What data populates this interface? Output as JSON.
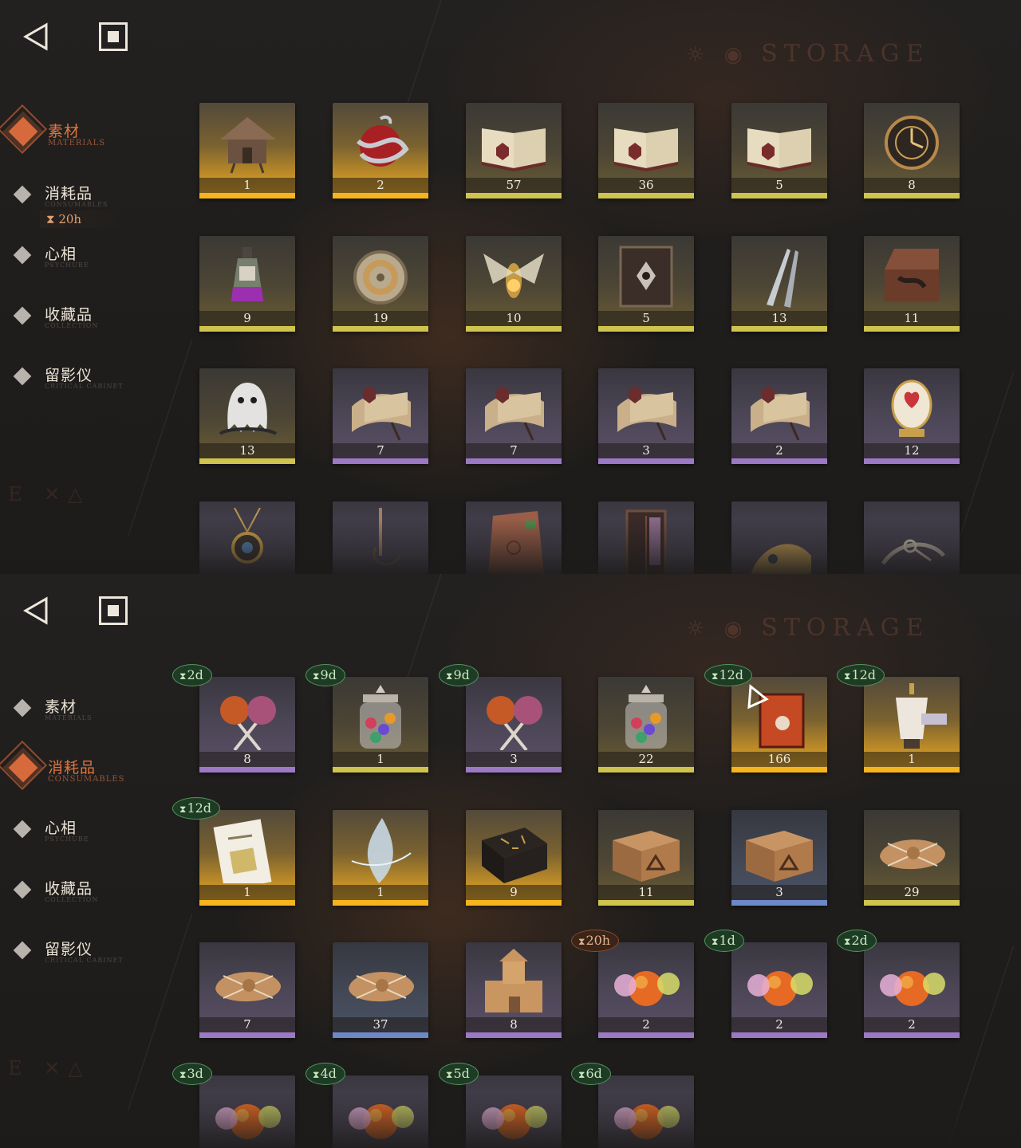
{
  "colors": {
    "accent": "#d76a3c",
    "gold": "#f6b41d",
    "yellow": "#cfc44e",
    "purple": "#9c79c4",
    "blue": "#6d88c8",
    "expiry_green": "#53955f",
    "expiry_orange": "#8b4c2c"
  },
  "watermark": {
    "symbols": "☼ ◉",
    "text": "STORAGE",
    "bg_letters": "E ✕△"
  },
  "screens": [
    {
      "back_icon": "back-triangle-icon",
      "home_icon": "square-stop-icon",
      "nav": [
        {
          "label": "素材",
          "sub": "MATERIALS",
          "active": true
        },
        {
          "label": "消耗品",
          "sub": "CONSUMABLES",
          "active": false
        },
        {
          "label": "心相",
          "sub": "PSYCHUBE",
          "active": false
        },
        {
          "label": "收藏品",
          "sub": "COLLECTION",
          "active": false
        },
        {
          "label": "留影仪",
          "sub": "CRITICAL CABINET",
          "active": false
        }
      ],
      "nav_timer": "20h",
      "items": [
        {
          "icon": "hut-icon",
          "qty": "1",
          "rarity": "gold"
        },
        {
          "icon": "apple-snake-icon",
          "qty": "2",
          "rarity": "gold"
        },
        {
          "icon": "book-icon",
          "qty": "57",
          "rarity": "yellow"
        },
        {
          "icon": "book-icon",
          "qty": "36",
          "rarity": "yellow"
        },
        {
          "icon": "book-icon",
          "qty": "5",
          "rarity": "yellow"
        },
        {
          "icon": "clockwork-icon",
          "qty": "8",
          "rarity": "yellow"
        },
        {
          "icon": "potion-bottle-icon",
          "qty": "9",
          "rarity": "yellow"
        },
        {
          "icon": "compass-icon",
          "qty": "19",
          "rarity": "yellow"
        },
        {
          "icon": "moth-icon",
          "qty": "10",
          "rarity": "yellow"
        },
        {
          "icon": "tome-icon",
          "qty": "5",
          "rarity": "yellow"
        },
        {
          "icon": "blades-icon",
          "qty": "13",
          "rarity": "yellow"
        },
        {
          "icon": "chest-icon",
          "qty": "11",
          "rarity": "yellow"
        },
        {
          "icon": "ghost-icon",
          "qty": "13",
          "rarity": "yellow"
        },
        {
          "icon": "scroll-icon",
          "qty": "7",
          "rarity": "purple"
        },
        {
          "icon": "scroll-icon",
          "qty": "7",
          "rarity": "purple"
        },
        {
          "icon": "scroll-icon",
          "qty": "3",
          "rarity": "purple"
        },
        {
          "icon": "scroll-icon",
          "qty": "2",
          "rarity": "purple"
        },
        {
          "icon": "egg-icon",
          "qty": "12",
          "rarity": "purple"
        },
        {
          "icon": "amulet-icon",
          "qty": "",
          "rarity": "purple"
        },
        {
          "icon": "pendulum-icon",
          "qty": "",
          "rarity": "purple"
        },
        {
          "icon": "stone-tablet-icon",
          "qty": "",
          "rarity": "purple"
        },
        {
          "icon": "mirror-icon",
          "qty": "",
          "rarity": "purple"
        },
        {
          "icon": "helmet-icon",
          "qty": "",
          "rarity": "purple"
        },
        {
          "icon": "winged-key-icon",
          "qty": "",
          "rarity": "purple"
        }
      ]
    },
    {
      "back_icon": "back-triangle-icon",
      "home_icon": "square-stop-icon",
      "nav": [
        {
          "label": "素材",
          "sub": "MATERIALS",
          "active": false
        },
        {
          "label": "消耗品",
          "sub": "CONSUMABLES",
          "active": true
        },
        {
          "label": "心相",
          "sub": "PSYCHUBE",
          "active": false
        },
        {
          "label": "收藏品",
          "sub": "COLLECTION",
          "active": false
        },
        {
          "label": "留影仪",
          "sub": "CRITICAL CABINET",
          "active": false
        }
      ],
      "items": [
        {
          "icon": "lollipop-icon",
          "qty": "8",
          "rarity": "purple",
          "expire": "2d"
        },
        {
          "icon": "candy-jar-icon",
          "qty": "1",
          "rarity": "yellow",
          "expire": "9d"
        },
        {
          "icon": "lollipop-icon",
          "qty": "3",
          "rarity": "purple",
          "expire": "9d"
        },
        {
          "icon": "candy-jar-icon",
          "qty": "22",
          "rarity": "yellow",
          "expire": ""
        },
        {
          "icon": "red-book-icon",
          "qty": "166",
          "rarity": "gold",
          "expire": "12d"
        },
        {
          "icon": "mannequin-icon",
          "qty": "1",
          "rarity": "gold",
          "expire": "12d"
        },
        {
          "icon": "ticket-icon",
          "qty": "1",
          "rarity": "gold",
          "expire": "12d"
        },
        {
          "icon": "crystal-icon",
          "qty": "1",
          "rarity": "gold",
          "expire": ""
        },
        {
          "icon": "rune-box-icon",
          "qty": "9",
          "rarity": "gold",
          "expire": ""
        },
        {
          "icon": "crate-icon",
          "qty": "11",
          "rarity": "yellow",
          "expire": ""
        },
        {
          "icon": "crate-icon",
          "qty": "3",
          "rarity": "blue",
          "expire": ""
        },
        {
          "icon": "parcel-icon",
          "qty": "29",
          "rarity": "yellow",
          "expire": ""
        },
        {
          "icon": "parcel-icon",
          "qty": "7",
          "rarity": "purple",
          "expire": ""
        },
        {
          "icon": "parcel-icon",
          "qty": "37",
          "rarity": "blue",
          "expire": ""
        },
        {
          "icon": "castle-icon",
          "qty": "8",
          "rarity": "purple",
          "expire": ""
        },
        {
          "icon": "candies-icon",
          "qty": "2",
          "rarity": "purple",
          "expire": "20h",
          "expire_style": "orange"
        },
        {
          "icon": "candies-icon",
          "qty": "2",
          "rarity": "purple",
          "expire": "1d"
        },
        {
          "icon": "candies-icon",
          "qty": "2",
          "rarity": "purple",
          "expire": "2d"
        },
        {
          "icon": "candies-icon",
          "qty": "",
          "rarity": "purple",
          "expire": "3d"
        },
        {
          "icon": "candies-icon",
          "qty": "",
          "rarity": "purple",
          "expire": "4d"
        },
        {
          "icon": "candies-icon",
          "qty": "",
          "rarity": "purple",
          "expire": "5d"
        },
        {
          "icon": "candies-icon",
          "qty": "",
          "rarity": "purple",
          "expire": "6d"
        }
      ]
    }
  ]
}
